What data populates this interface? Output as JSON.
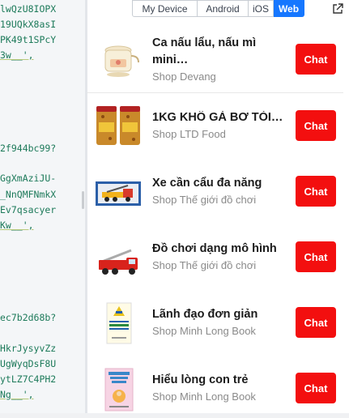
{
  "code_lines": [
    {
      "text": "lwQzU8IOPX",
      "u": false
    },
    {
      "text": "19UQkX8asI",
      "u": false
    },
    {
      "text": "PK49t1SPcY",
      "u": false
    },
    {
      "text": "3w__',",
      "u": true
    },
    {
      "text": "2f944bc99?",
      "u": false
    },
    {
      "text": "GgXmAziJU-",
      "u": false
    },
    {
      "text": "_NnQMFNmkX",
      "u": false
    },
    {
      "text": "Ev7qsacyer",
      "u": false
    },
    {
      "text": "Kw__',",
      "u": true
    },
    {
      "text": "ec7b2d68b?",
      "u": false
    },
    {
      "text": "HkrJysyvZz",
      "u": false
    },
    {
      "text": "UgWyqDsF8U",
      "u": false
    },
    {
      "text": "ytLZ7C4PH2",
      "u": false
    },
    {
      "text": "Ng__',",
      "u": true
    }
  ],
  "tabs": {
    "my_device": "My Device",
    "android": "Android",
    "ios": "iOS",
    "web": "Web",
    "active": "Web"
  },
  "products": [
    {
      "title": "Ca nấu lẩu, nấu mì",
      "title2": "mini…",
      "shop": "Shop Devang",
      "chat": "Chat",
      "icon": "cooker-icon"
    },
    {
      "title": "1KG KHÔ GÀ BƠ TỎI…",
      "shop": "Shop LTD Food",
      "chat": "Chat",
      "icon": "snack-jars-icon"
    },
    {
      "title": "Xe cần cẩu đa năng",
      "shop": "Shop Thế giới đồ chơi",
      "chat": "Chat",
      "icon": "crane-truck-icon"
    },
    {
      "title": "Đồ chơi dạng mô hình",
      "shop": "Shop Thế giới đồ chơi",
      "chat": "Chat",
      "icon": "fire-truck-icon"
    },
    {
      "title": "Lãnh đạo đơn giản",
      "shop": "Shop Minh Long Book",
      "chat": "Chat",
      "icon": "book-cover-icon",
      "cover": "LÃNH ĐẠO ĐƠN GIẢN"
    },
    {
      "title": "Hiểu lòng con trẻ",
      "shop": "Shop Minh Long Book",
      "chat": "Chat",
      "icon": "book-cover-icon",
      "cover": "Hiểu lòng con trẻ"
    }
  ],
  "colors": {
    "accent": "#1677ff",
    "chat": "#f30f0f",
    "code": "#1d7a5a"
  }
}
